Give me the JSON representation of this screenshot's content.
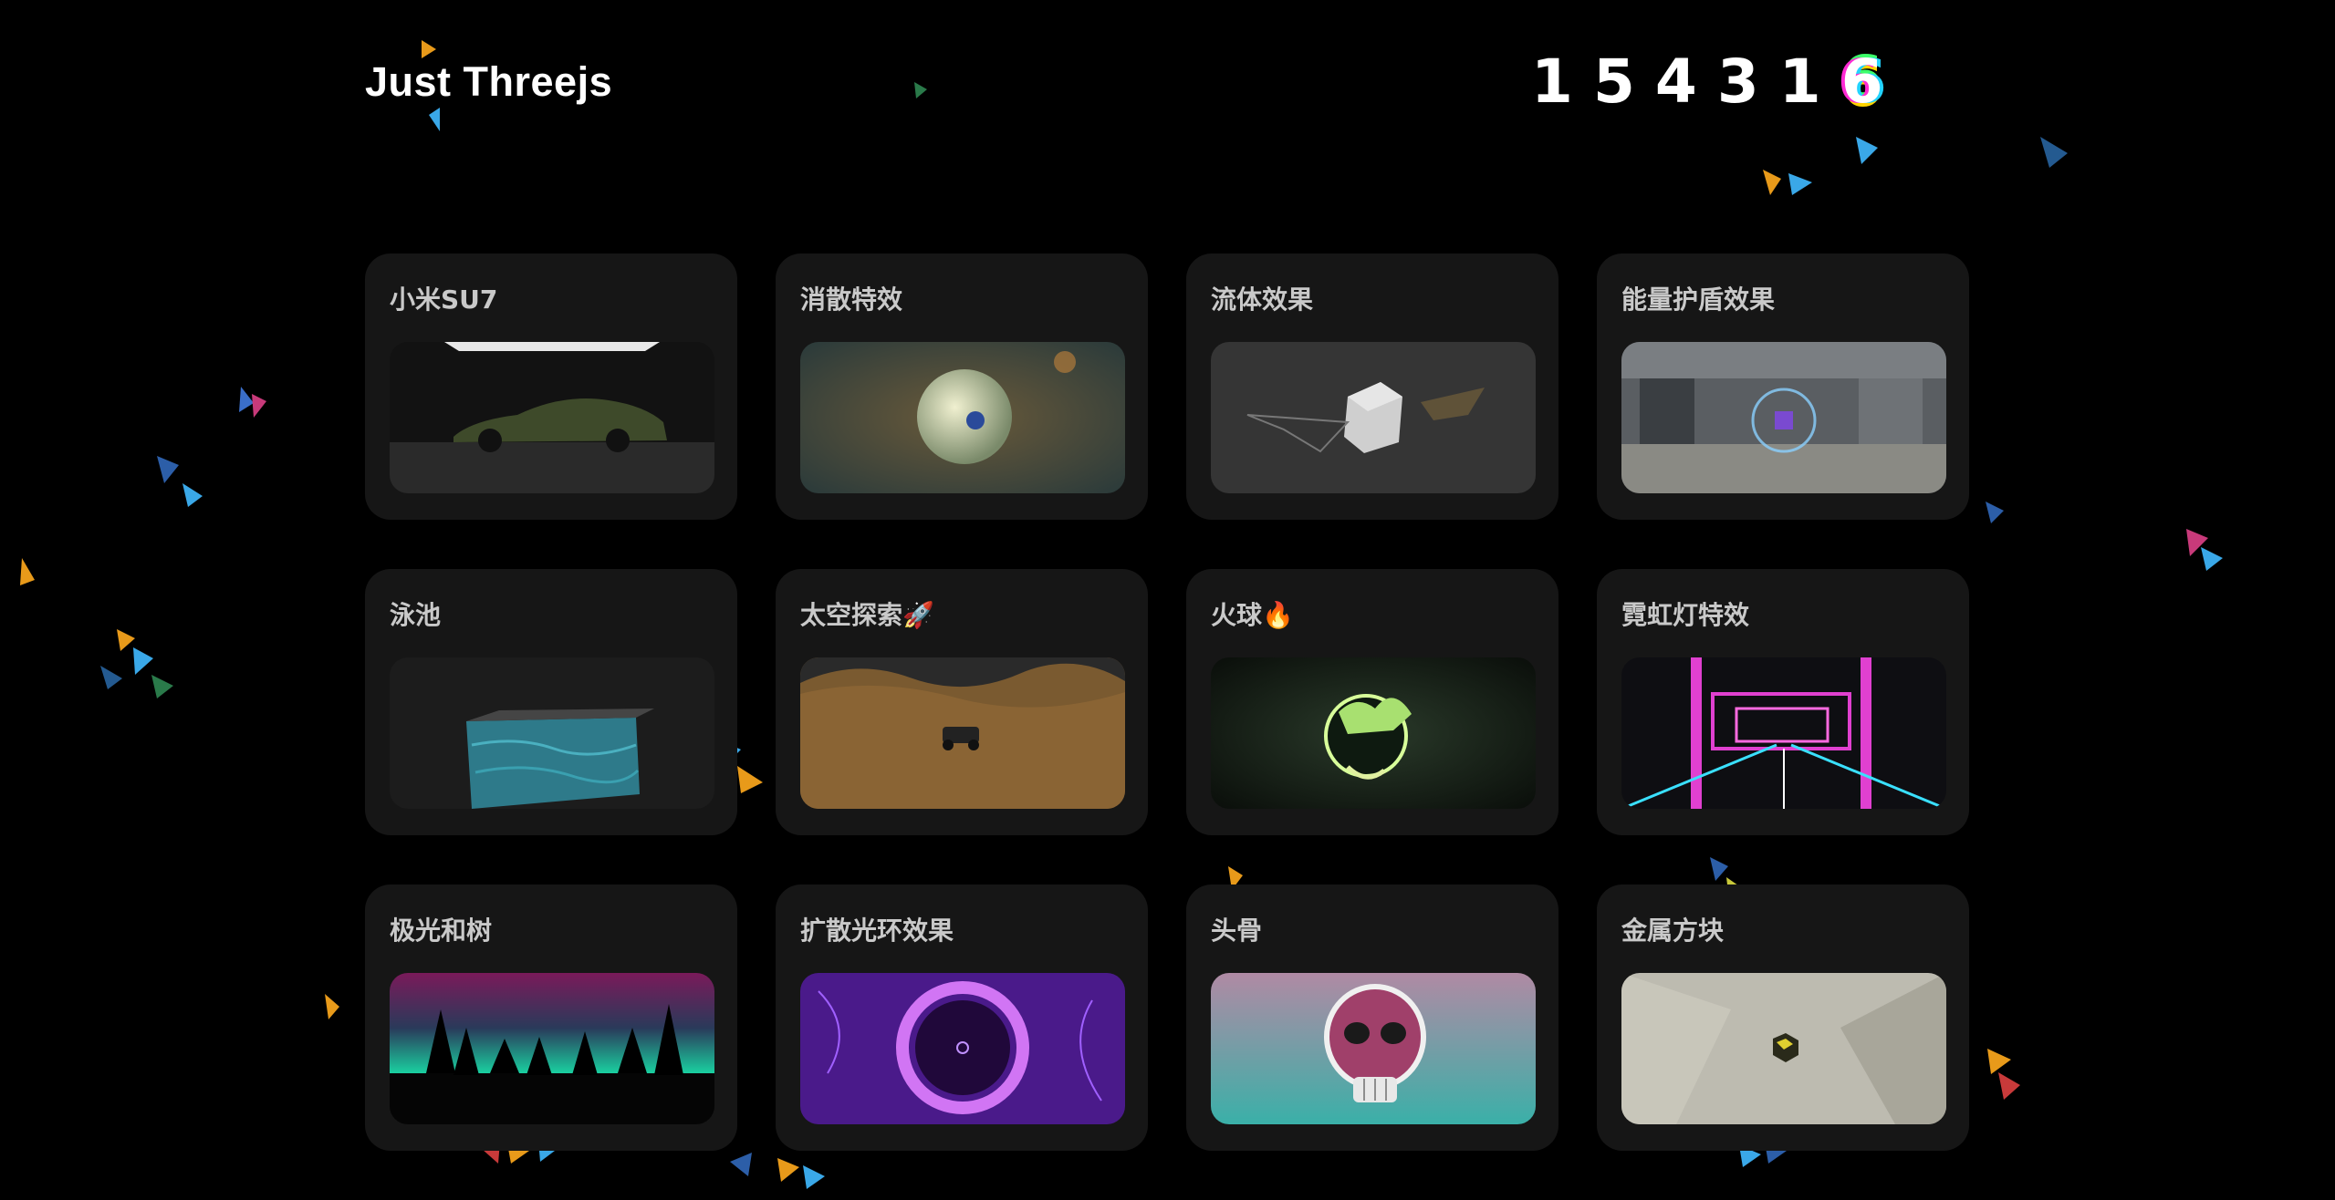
{
  "header": {
    "site_title": "Just Threejs",
    "counter_digits": [
      "1",
      "5",
      "4",
      "3",
      "1",
      "6"
    ]
  },
  "cards": [
    {
      "title": "小米SU7",
      "thumbnail_icon": "car-scene-icon"
    },
    {
      "title": "消散特效",
      "thumbnail_icon": "dissolve-planet-icon"
    },
    {
      "title": "流体效果",
      "thumbnail_icon": "fluid-cube-icon"
    },
    {
      "title": "能量护盾效果",
      "thumbnail_icon": "energy-shield-icon"
    },
    {
      "title": "泳池",
      "thumbnail_icon": "pool-icon"
    },
    {
      "title": "太空探索🚀",
      "thumbnail_icon": "space-rover-icon"
    },
    {
      "title": "火球🔥",
      "thumbnail_icon": "fireball-icon"
    },
    {
      "title": "霓虹灯特效",
      "thumbnail_icon": "neon-tunnel-icon"
    },
    {
      "title": "极光和树",
      "thumbnail_icon": "aurora-trees-icon"
    },
    {
      "title": "扩散光环效果",
      "thumbnail_icon": "purple-halo-icon"
    },
    {
      "title": "头骨",
      "thumbnail_icon": "skull-icon"
    },
    {
      "title": "金属方块",
      "thumbnail_icon": "metal-cube-icon"
    }
  ]
}
